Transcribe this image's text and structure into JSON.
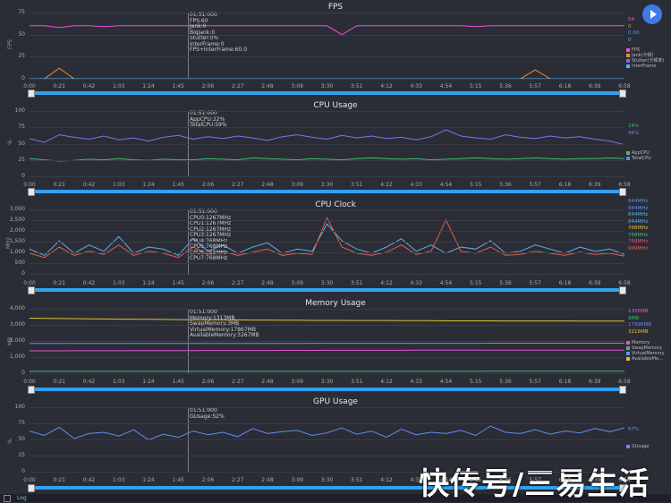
{
  "x_ticks": [
    "0:00",
    "0:21",
    "0:42",
    "1:03",
    "1:24",
    "1:45",
    "2:06",
    "2:27",
    "2:48",
    "3:09",
    "3:30",
    "3:51",
    "4:12",
    "4:33",
    "4:54",
    "5:15",
    "5:36",
    "5:57",
    "6:18",
    "6:39",
    "6:58"
  ],
  "play_button": "play-icon",
  "log_label": "Log",
  "watermark": "快传号/三易生活",
  "panels": {
    "fps": {
      "title": "FPS",
      "unit": "FPS",
      "yticks": [
        "75",
        "50",
        "25",
        "0"
      ],
      "tooltip": "01:51:000\nFPS:60\nJank:0\nBigJank:0\nStutter:0%\nInterFrame:0\nFPS+InterFrame:60.0",
      "right_values": [
        "58",
        "0",
        "0.00",
        "0"
      ],
      "right_colors": [
        "#e94fd6",
        "#e98f3a",
        "#5f8ef0",
        "#5fb0e8"
      ],
      "legend": [
        "FPS",
        "Jank(卡顿)",
        "Stutter(卡顿率)",
        "InterFrame"
      ],
      "legend_colors": [
        "#e94fd6",
        "#e98f3a",
        "#7a6cf0",
        "#5fb0e8"
      ]
    },
    "cpu_usage": {
      "title": "CPU Usage",
      "unit": "%",
      "yticks": [
        "100",
        "75",
        "50",
        "25",
        "0"
      ],
      "tooltip": "01:51:000\nAppCPU:22%\nTotalCPU:59%",
      "right_values": [
        "24%",
        "46%"
      ],
      "right_colors": [
        "#3fbf73",
        "#6e7cf0"
      ],
      "legend": [
        "AppCPU",
        "TotalCPU"
      ],
      "legend_colors": [
        "#3fbf73",
        "#6e7cf0"
      ]
    },
    "cpu_clock": {
      "title": "CPU Clock",
      "unit": "MHz",
      "yticks": [
        "3,000",
        "2,500",
        "2,000",
        "1,500",
        "1,000",
        "500",
        "0"
      ],
      "tooltip": "01:51:000\nCPU0:1267MHz\nCPU1:1267MHz\nCPU2:1267MHz\nCPU3:1267MHz\nCPU4:768MHz\nCPU5:768MHz\nCPU6:768MHz\nCPU7:768MHz",
      "right_values": [
        "844MHz",
        "844MHz",
        "844MHz",
        "844MHz",
        "768MHz",
        "768MHz",
        "768MHz",
        "999MHz"
      ],
      "right_colors": [
        "#5f8ef0",
        "#5f8ef0",
        "#5fb0e8",
        "#5fb0e8",
        "#e0c030",
        "#3fbf73",
        "#e94f7a",
        "#e06050"
      ]
    },
    "memory": {
      "title": "Memory Usage",
      "unit": "MB",
      "yticks": [
        "4,000",
        "3,000",
        "2,000",
        "1,000",
        "0"
      ],
      "tooltip": "01:51:000\nMemory:1313MB\nSwapMemory:3MB\nVirtualMemory:17867MB\nAvailableMemory:3267MB",
      "right_values": [
        "1356MB",
        "9MB",
        "17996MB",
        "3216MB"
      ],
      "right_colors": [
        "#e94fd6",
        "#3fbf73",
        "#5f8ef0",
        "#e0c030"
      ],
      "legend": [
        "Memory",
        "SwapMemory",
        "VirtualMemory",
        "AvailableMe..."
      ],
      "legend_colors": [
        "#e94fd6",
        "#3fbf73",
        "#5f8ef0",
        "#e0c030"
      ]
    },
    "gpu": {
      "title": "GPU Usage",
      "unit": "%",
      "yticks": [
        "100",
        "75",
        "50",
        "25",
        "0"
      ],
      "tooltip": "01:51:000\nGUsage:52%",
      "right_values": [
        "67%"
      ],
      "right_colors": [
        "#5f8ef0"
      ],
      "legend": [
        "GUsage"
      ],
      "legend_colors": [
        "#5f8ef0"
      ]
    }
  },
  "chart_data": [
    {
      "type": "line",
      "title": "FPS",
      "ylim": [
        0,
        75
      ],
      "series": [
        {
          "name": "FPS",
          "values": [
            60,
            60,
            58,
            60,
            60,
            59,
            60,
            60,
            60,
            60,
            60,
            60,
            60,
            60,
            60,
            60,
            60,
            60,
            60,
            60,
            60,
            50,
            60,
            60,
            60,
            60,
            60,
            60,
            60,
            60,
            59,
            60,
            60,
            60,
            60,
            60,
            60,
            60,
            60,
            60,
            60
          ]
        },
        {
          "name": "Jank(卡顿)",
          "values": [
            0,
            0,
            12,
            0,
            0,
            0,
            0,
            0,
            0,
            0,
            0,
            0,
            0,
            0,
            0,
            0,
            0,
            0,
            0,
            0,
            0,
            0,
            0,
            0,
            0,
            0,
            0,
            0,
            0,
            0,
            0,
            0,
            0,
            0,
            10,
            0,
            0,
            0,
            0,
            0,
            0
          ]
        },
        {
          "name": "Stutter(卡顿率)",
          "values": [
            0,
            0,
            0,
            0,
            0,
            0,
            0,
            0,
            0,
            0,
            0,
            0,
            0,
            0,
            0,
            0,
            0,
            0,
            0,
            0,
            0,
            0,
            0,
            0,
            0,
            0,
            0,
            0,
            0,
            0,
            0,
            0,
            0,
            0,
            0,
            0,
            0,
            0,
            0,
            0,
            0
          ]
        },
        {
          "name": "InterFrame",
          "values": [
            0,
            0,
            0,
            0,
            0,
            0,
            0,
            0,
            0,
            0,
            0,
            0,
            0,
            0,
            0,
            0,
            0,
            0,
            0,
            0,
            0,
            0,
            0,
            0,
            0,
            0,
            0,
            0,
            0,
            0,
            0,
            0,
            0,
            0,
            0,
            0,
            0,
            0,
            0,
            0,
            0
          ]
        }
      ]
    },
    {
      "type": "line",
      "title": "CPU Usage",
      "ylim": [
        0,
        100
      ],
      "series": [
        {
          "name": "AppCPU",
          "values": [
            24,
            22,
            20,
            21,
            23,
            22,
            24,
            22,
            21,
            23,
            22,
            22,
            24,
            23,
            22,
            25,
            24,
            23,
            22,
            24,
            23,
            22,
            24,
            25,
            24,
            23,
            24,
            22,
            23,
            24,
            25,
            24,
            23,
            24,
            25,
            24,
            23,
            24,
            24,
            25,
            24
          ]
        },
        {
          "name": "TotalCPU",
          "values": [
            56,
            50,
            62,
            58,
            55,
            60,
            54,
            57,
            52,
            58,
            61,
            55,
            59,
            56,
            60,
            57,
            53,
            59,
            62,
            58,
            55,
            61,
            57,
            60,
            56,
            58,
            54,
            59,
            70,
            60,
            57,
            55,
            62,
            58,
            56,
            60,
            57,
            59,
            55,
            52,
            46
          ]
        }
      ]
    },
    {
      "type": "line",
      "title": "CPU Clock",
      "ylim": [
        0,
        3000
      ],
      "series": [
        {
          "name": "CPU0-3",
          "values": [
            1100,
            800,
            1500,
            900,
            1300,
            1000,
            1700,
            900,
            1200,
            1100,
            800,
            1600,
            1000,
            1300,
            900,
            1200,
            1400,
            900,
            1100,
            1000,
            2300,
            1500,
            1100,
            900,
            1200,
            1600,
            1000,
            1300,
            900,
            1200,
            1100,
            1500,
            900,
            1000,
            1300,
            1100,
            900,
            1200,
            1000,
            1100,
            844
          ]
        },
        {
          "name": "CPU4-7",
          "values": [
            900,
            700,
            1200,
            800,
            1000,
            850,
            1300,
            800,
            1000,
            900,
            700,
            1200,
            850,
            1000,
            800,
            950,
            1100,
            800,
            900,
            850,
            2600,
            1200,
            900,
            800,
            950,
            1300,
            850,
            1000,
            2500,
            1000,
            900,
            1200,
            800,
            850,
            1000,
            900,
            800,
            950,
            850,
            900,
            768
          ]
        }
      ]
    },
    {
      "type": "line",
      "title": "Memory Usage",
      "ylim": [
        0,
        4000
      ],
      "series": [
        {
          "name": "Memory",
          "values": [
            1313,
            1313,
            1315,
            1320,
            1320,
            1320,
            1322,
            1325,
            1325,
            1330,
            1330,
            1330,
            1335,
            1335,
            1338,
            1340,
            1340,
            1342,
            1345,
            1345,
            1346,
            1348,
            1348,
            1350,
            1350,
            1350,
            1352,
            1352,
            1353,
            1354,
            1354,
            1355,
            1355,
            1355,
            1356,
            1356,
            1356,
            1356,
            1356,
            1356,
            1356
          ]
        },
        {
          "name": "SwapMemory",
          "values": [
            3,
            3,
            3,
            3,
            3,
            3,
            3,
            4,
            4,
            4,
            4,
            5,
            5,
            5,
            5,
            6,
            6,
            6,
            6,
            6,
            7,
            7,
            7,
            7,
            7,
            8,
            8,
            8,
            8,
            8,
            8,
            9,
            9,
            9,
            9,
            9,
            9,
            9,
            9,
            9,
            9
          ]
        },
        {
          "name": "VirtualMemory",
          "values": [
            1786,
            1786,
            1786,
            1786,
            1787,
            1787,
            1787,
            1787,
            1788,
            1788,
            1788,
            1789,
            1789,
            1789,
            1790,
            1790,
            1790,
            1791,
            1791,
            1792,
            1792,
            1793,
            1793,
            1794,
            1794,
            1795,
            1795,
            1796,
            1796,
            1797,
            1797,
            1798,
            1798,
            1798,
            1799,
            1799,
            1799,
            1799,
            1800,
            1800,
            1800
          ]
        },
        {
          "name": "AvailableMemory",
          "values": [
            3400,
            3390,
            3380,
            3370,
            3360,
            3350,
            3340,
            3340,
            3330,
            3320,
            3310,
            3300,
            3300,
            3290,
            3290,
            3280,
            3280,
            3270,
            3270,
            3260,
            3260,
            3260,
            3250,
            3250,
            3250,
            3240,
            3240,
            3240,
            3230,
            3230,
            3230,
            3230,
            3220,
            3220,
            3220,
            3220,
            3220,
            3216,
            3216,
            3216,
            3216
          ]
        }
      ]
    },
    {
      "type": "line",
      "title": "GPU Usage",
      "ylim": [
        0,
        100
      ],
      "series": [
        {
          "name": "GUsage",
          "values": [
            62,
            55,
            68,
            50,
            58,
            60,
            54,
            64,
            48,
            57,
            52,
            62,
            56,
            60,
            53,
            66,
            58,
            61,
            63,
            55,
            59,
            67,
            57,
            62,
            52,
            65,
            56,
            60,
            58,
            63,
            55,
            70,
            60,
            58,
            64,
            57,
            62,
            59,
            66,
            61,
            67
          ]
        }
      ]
    }
  ]
}
